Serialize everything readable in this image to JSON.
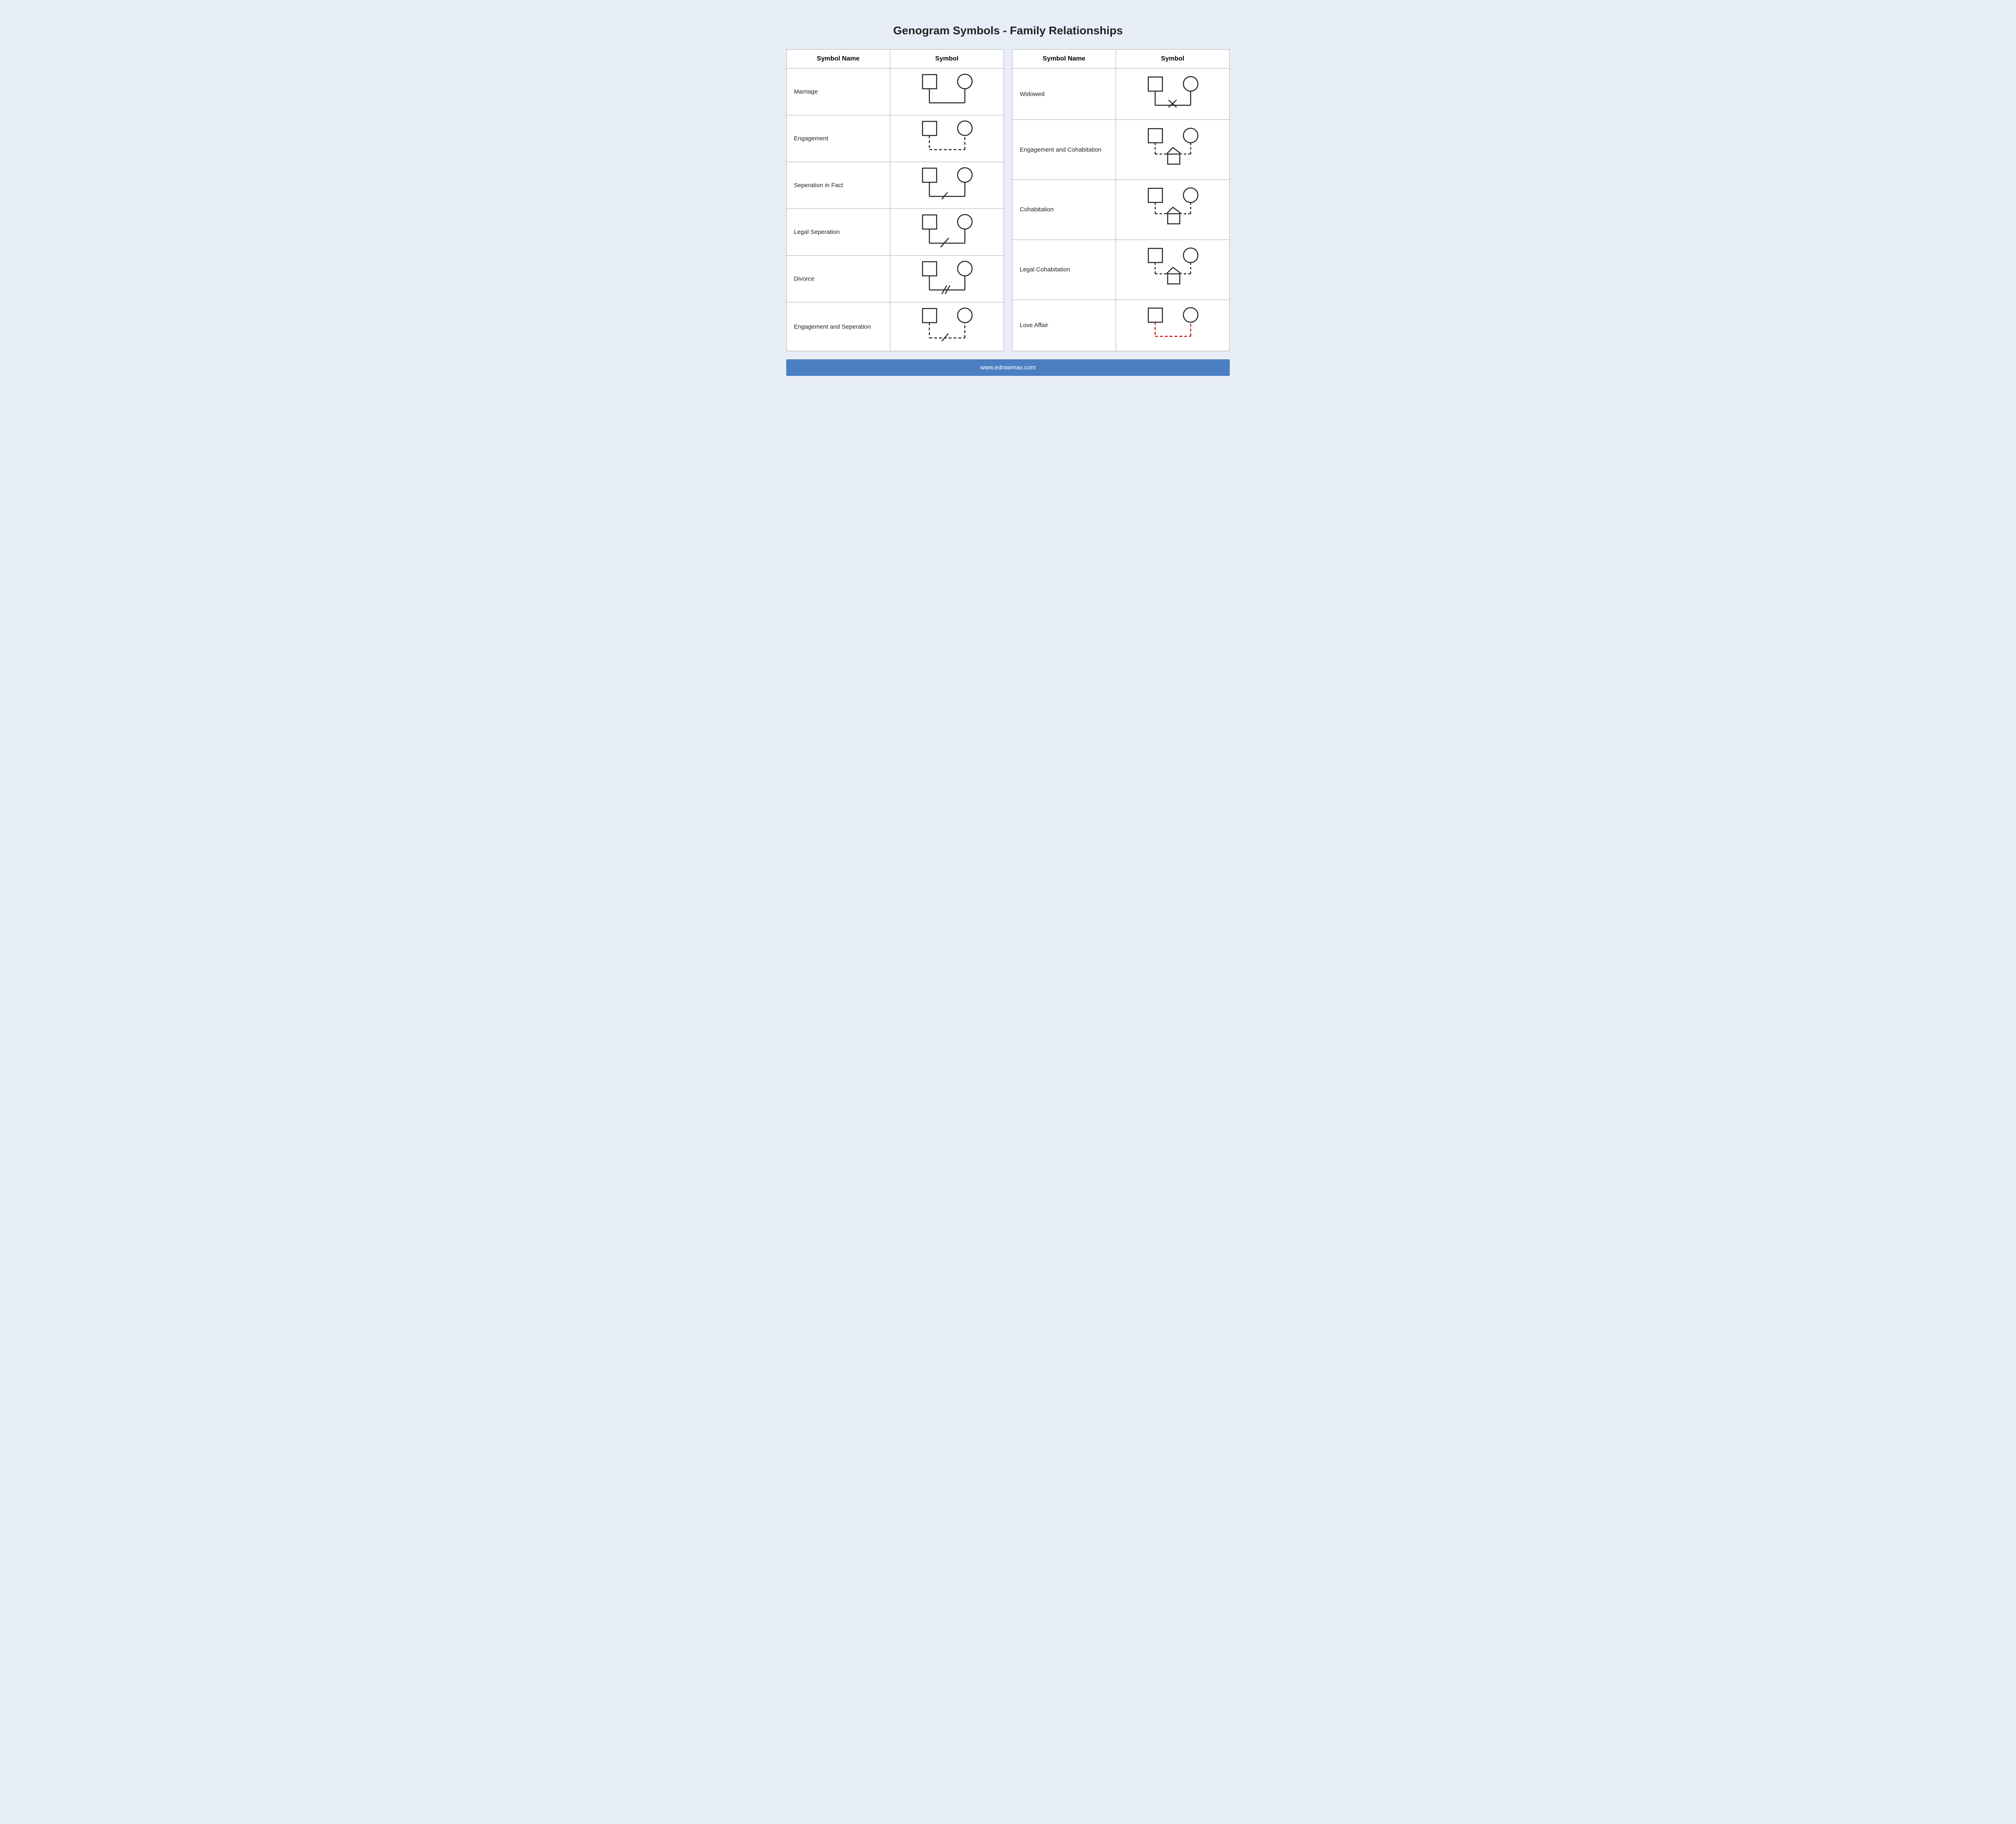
{
  "page": {
    "title": "Genogram Symbols - Family Relationships",
    "footer": "www.edrawmax.com"
  },
  "left_table": {
    "headers": [
      "Symbol Name",
      "Symbol"
    ],
    "rows": [
      {
        "name": "Marriage"
      },
      {
        "name": "Engagement"
      },
      {
        "name": "Seperation in Fact"
      },
      {
        "name": "Legal Seperation"
      },
      {
        "name": "Divorce"
      },
      {
        "name": "Engagement and Seperation"
      }
    ]
  },
  "right_table": {
    "headers": [
      "Symbol Name",
      "Symbol"
    ],
    "rows": [
      {
        "name": "Widowed"
      },
      {
        "name": "Engagement and Cohabitation"
      },
      {
        "name": "Cohabitation"
      },
      {
        "name": "Legal Cohabitation"
      },
      {
        "name": "Love Affair"
      }
    ]
  }
}
